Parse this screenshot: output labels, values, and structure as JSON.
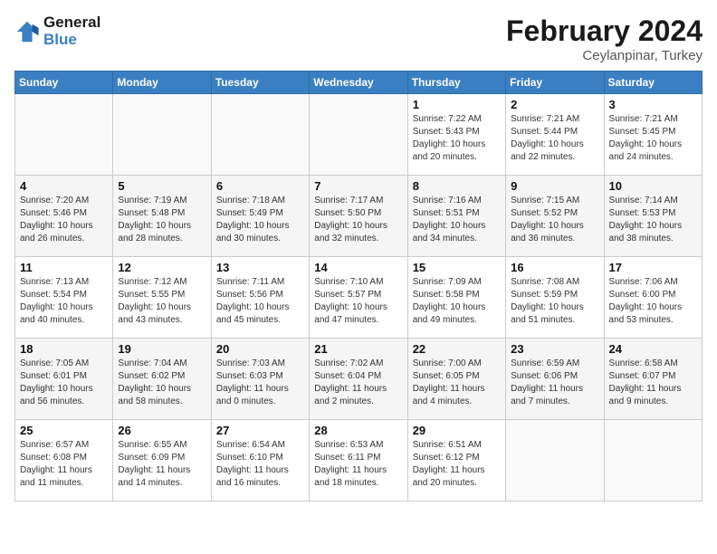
{
  "header": {
    "logo_line1": "General",
    "logo_line2": "Blue",
    "title": "February 2024",
    "subtitle": "Ceylanpinar, Turkey"
  },
  "weekdays": [
    "Sunday",
    "Monday",
    "Tuesday",
    "Wednesday",
    "Thursday",
    "Friday",
    "Saturday"
  ],
  "weeks": [
    {
      "shaded": false,
      "days": [
        {
          "date": "",
          "info": ""
        },
        {
          "date": "",
          "info": ""
        },
        {
          "date": "",
          "info": ""
        },
        {
          "date": "",
          "info": ""
        },
        {
          "date": "1",
          "info": "Sunrise: 7:22 AM\nSunset: 5:43 PM\nDaylight: 10 hours\nand 20 minutes."
        },
        {
          "date": "2",
          "info": "Sunrise: 7:21 AM\nSunset: 5:44 PM\nDaylight: 10 hours\nand 22 minutes."
        },
        {
          "date": "3",
          "info": "Sunrise: 7:21 AM\nSunset: 5:45 PM\nDaylight: 10 hours\nand 24 minutes."
        }
      ]
    },
    {
      "shaded": true,
      "days": [
        {
          "date": "4",
          "info": "Sunrise: 7:20 AM\nSunset: 5:46 PM\nDaylight: 10 hours\nand 26 minutes."
        },
        {
          "date": "5",
          "info": "Sunrise: 7:19 AM\nSunset: 5:48 PM\nDaylight: 10 hours\nand 28 minutes."
        },
        {
          "date": "6",
          "info": "Sunrise: 7:18 AM\nSunset: 5:49 PM\nDaylight: 10 hours\nand 30 minutes."
        },
        {
          "date": "7",
          "info": "Sunrise: 7:17 AM\nSunset: 5:50 PM\nDaylight: 10 hours\nand 32 minutes."
        },
        {
          "date": "8",
          "info": "Sunrise: 7:16 AM\nSunset: 5:51 PM\nDaylight: 10 hours\nand 34 minutes."
        },
        {
          "date": "9",
          "info": "Sunrise: 7:15 AM\nSunset: 5:52 PM\nDaylight: 10 hours\nand 36 minutes."
        },
        {
          "date": "10",
          "info": "Sunrise: 7:14 AM\nSunset: 5:53 PM\nDaylight: 10 hours\nand 38 minutes."
        }
      ]
    },
    {
      "shaded": false,
      "days": [
        {
          "date": "11",
          "info": "Sunrise: 7:13 AM\nSunset: 5:54 PM\nDaylight: 10 hours\nand 40 minutes."
        },
        {
          "date": "12",
          "info": "Sunrise: 7:12 AM\nSunset: 5:55 PM\nDaylight: 10 hours\nand 43 minutes."
        },
        {
          "date": "13",
          "info": "Sunrise: 7:11 AM\nSunset: 5:56 PM\nDaylight: 10 hours\nand 45 minutes."
        },
        {
          "date": "14",
          "info": "Sunrise: 7:10 AM\nSunset: 5:57 PM\nDaylight: 10 hours\nand 47 minutes."
        },
        {
          "date": "15",
          "info": "Sunrise: 7:09 AM\nSunset: 5:58 PM\nDaylight: 10 hours\nand 49 minutes."
        },
        {
          "date": "16",
          "info": "Sunrise: 7:08 AM\nSunset: 5:59 PM\nDaylight: 10 hours\nand 51 minutes."
        },
        {
          "date": "17",
          "info": "Sunrise: 7:06 AM\nSunset: 6:00 PM\nDaylight: 10 hours\nand 53 minutes."
        }
      ]
    },
    {
      "shaded": true,
      "days": [
        {
          "date": "18",
          "info": "Sunrise: 7:05 AM\nSunset: 6:01 PM\nDaylight: 10 hours\nand 56 minutes."
        },
        {
          "date": "19",
          "info": "Sunrise: 7:04 AM\nSunset: 6:02 PM\nDaylight: 10 hours\nand 58 minutes."
        },
        {
          "date": "20",
          "info": "Sunrise: 7:03 AM\nSunset: 6:03 PM\nDaylight: 11 hours\nand 0 minutes."
        },
        {
          "date": "21",
          "info": "Sunrise: 7:02 AM\nSunset: 6:04 PM\nDaylight: 11 hours\nand 2 minutes."
        },
        {
          "date": "22",
          "info": "Sunrise: 7:00 AM\nSunset: 6:05 PM\nDaylight: 11 hours\nand 4 minutes."
        },
        {
          "date": "23",
          "info": "Sunrise: 6:59 AM\nSunset: 6:06 PM\nDaylight: 11 hours\nand 7 minutes."
        },
        {
          "date": "24",
          "info": "Sunrise: 6:58 AM\nSunset: 6:07 PM\nDaylight: 11 hours\nand 9 minutes."
        }
      ]
    },
    {
      "shaded": false,
      "days": [
        {
          "date": "25",
          "info": "Sunrise: 6:57 AM\nSunset: 6:08 PM\nDaylight: 11 hours\nand 11 minutes."
        },
        {
          "date": "26",
          "info": "Sunrise: 6:55 AM\nSunset: 6:09 PM\nDaylight: 11 hours\nand 14 minutes."
        },
        {
          "date": "27",
          "info": "Sunrise: 6:54 AM\nSunset: 6:10 PM\nDaylight: 11 hours\nand 16 minutes."
        },
        {
          "date": "28",
          "info": "Sunrise: 6:53 AM\nSunset: 6:11 PM\nDaylight: 11 hours\nand 18 minutes."
        },
        {
          "date": "29",
          "info": "Sunrise: 6:51 AM\nSunset: 6:12 PM\nDaylight: 11 hours\nand 20 minutes."
        },
        {
          "date": "",
          "info": ""
        },
        {
          "date": "",
          "info": ""
        }
      ]
    }
  ]
}
